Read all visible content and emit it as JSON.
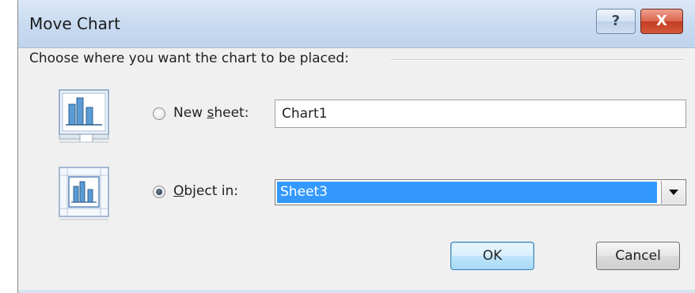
{
  "dialog": {
    "title": "Move Chart",
    "help_label": "?",
    "close_label": "X",
    "instruction": "Choose where you want the chart to be placed:"
  },
  "new_sheet": {
    "label_prefix": "New ",
    "label_accel": "s",
    "label_suffix": "heet:",
    "value": "Chart1",
    "checked": false,
    "icon": "new-sheet-chart-icon"
  },
  "object_in": {
    "label_accel": "O",
    "label_suffix": "bject in:",
    "selected_value": "Sheet3",
    "checked": true,
    "icon": "embedded-chart-icon"
  },
  "buttons": {
    "ok": "OK",
    "cancel": "Cancel"
  },
  "colors": {
    "selection": "#3399ff",
    "close_button": "#c13c22",
    "titlebar": "#c8daf0"
  }
}
